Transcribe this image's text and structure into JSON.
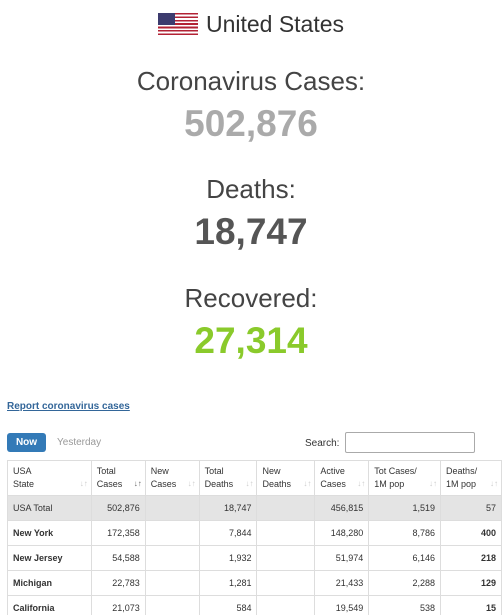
{
  "header": {
    "country": "United States",
    "flag_icon": "us-flag-icon"
  },
  "stats": {
    "cases_label": "Coronavirus Cases:",
    "cases_value": "502,876",
    "deaths_label": "Deaths:",
    "deaths_value": "18,747",
    "recovered_label": "Recovered:",
    "recovered_value": "27,314"
  },
  "colors": {
    "cases": "#aaaaaa",
    "deaths": "#555555",
    "recovered": "#8aca2b",
    "now_tab": "#337ab7",
    "link": "#336699"
  },
  "report_link": "Report coronavirus cases",
  "tabs": {
    "now": "Now",
    "yesterday": "Yesterday"
  },
  "search": {
    "label": "Search:",
    "value": ""
  },
  "table": {
    "columns": [
      {
        "line1": "USA",
        "line2": "State"
      },
      {
        "line1": "Total",
        "line2": "Cases"
      },
      {
        "line1": "New",
        "line2": "Cases"
      },
      {
        "line1": "Total",
        "line2": "Deaths"
      },
      {
        "line1": "New",
        "line2": "Deaths"
      },
      {
        "line1": "Active",
        "line2": "Cases"
      },
      {
        "line1": "Tot Cases/",
        "line2": "1M pop"
      },
      {
        "line1": "Deaths/",
        "line2": "1M pop"
      }
    ],
    "rows": [
      [
        "USA Total",
        "502,876",
        "",
        "18,747",
        "",
        "456,815",
        "1,519",
        "57"
      ],
      [
        "New York",
        "172,358",
        "",
        "7,844",
        "",
        "148,280",
        "8,786",
        "400"
      ],
      [
        "New Jersey",
        "54,588",
        "",
        "1,932",
        "",
        "51,974",
        "6,146",
        "218"
      ],
      [
        "Michigan",
        "22,783",
        "",
        "1,281",
        "",
        "21,433",
        "2,288",
        "129"
      ],
      [
        "California",
        "21,073",
        "",
        "584",
        "",
        "19,549",
        "538",
        "15"
      ]
    ]
  }
}
